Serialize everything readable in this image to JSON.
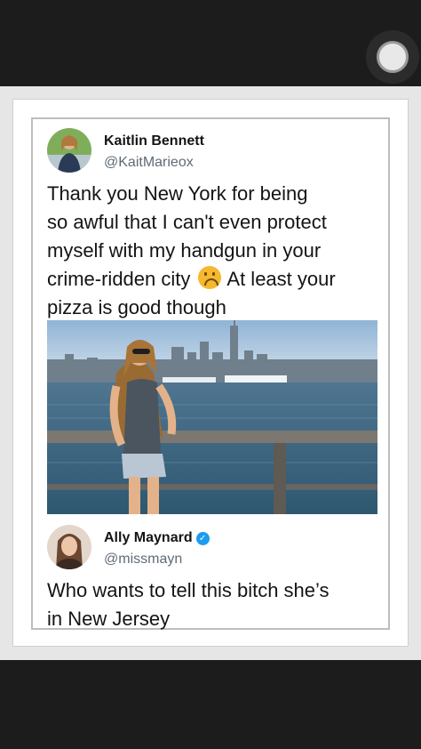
{
  "tweet": {
    "author_name": "Kaitlin Bennett",
    "author_handle": "@KaitMarieox",
    "text_line1": "Thank you New York for being",
    "text_line2": "so awful that I can't even protect",
    "text_line3": "myself with my handgun in your",
    "text_line4a": "crime-ridden city",
    "emoji_icon": "upside-down-face-emoji",
    "text_line4b": "At least your",
    "text_line5": "pizza is good though"
  },
  "reply": {
    "author_name": "Ally Maynard",
    "verified_icon": "verified-badge-icon",
    "author_handle": "@missmayn",
    "text_line1": "Who wants to tell this bitch she’s",
    "text_line2": "in New Jersey"
  },
  "colors": {
    "handle_gray": "#5e6b78",
    "verified_blue": "#1d9bf0",
    "dark_bars": "#1c1c1c"
  }
}
